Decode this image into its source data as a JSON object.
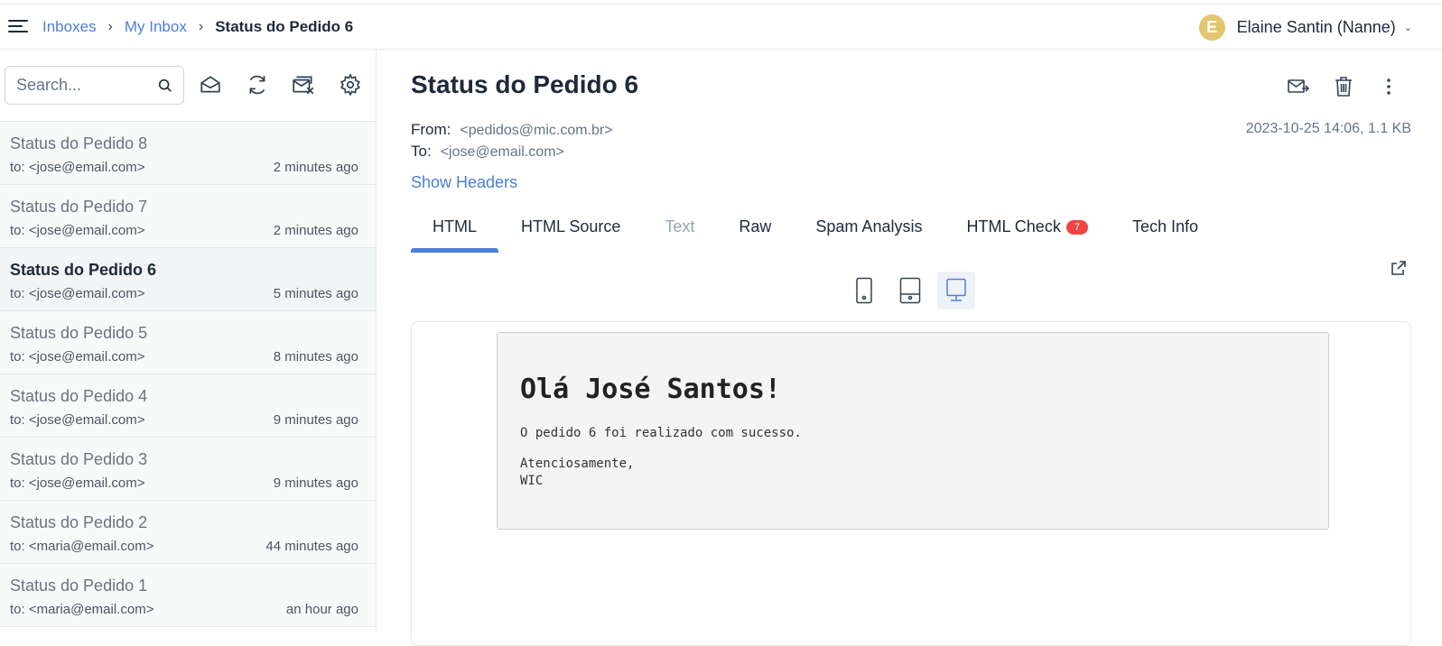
{
  "header": {
    "breadcrumb": [
      "Inboxes",
      "My Inbox",
      "Status do Pedido 6"
    ],
    "user_initial": "E",
    "user_name": "Elaine Santin (Nanne)"
  },
  "sidebar": {
    "search_placeholder": "Search...",
    "messages": [
      {
        "subject": "Status do Pedido 8",
        "to": "to: <jose@email.com>",
        "time": "2 minutes ago"
      },
      {
        "subject": "Status do Pedido 7",
        "to": "to: <jose@email.com>",
        "time": "2 minutes ago"
      },
      {
        "subject": "Status do Pedido 6",
        "to": "to: <jose@email.com>",
        "time": "5 minutes ago"
      },
      {
        "subject": "Status do Pedido 5",
        "to": "to: <jose@email.com>",
        "time": "8 minutes ago"
      },
      {
        "subject": "Status do Pedido 4",
        "to": "to: <jose@email.com>",
        "time": "9 minutes ago"
      },
      {
        "subject": "Status do Pedido 3",
        "to": "to: <jose@email.com>",
        "time": "9 minutes ago"
      },
      {
        "subject": "Status do Pedido 2",
        "to": "to: <maria@email.com>",
        "time": "44 minutes ago"
      },
      {
        "subject": "Status do Pedido 1",
        "to": "to: <maria@email.com>",
        "time": "an hour ago"
      }
    ]
  },
  "message": {
    "title": "Status do Pedido 6",
    "from_label": "From:",
    "from": "<pedidos@mic.com.br>",
    "to_label": "To:",
    "to": "<jose@email.com>",
    "date_size": "2023-10-25 14:06, 1.1 KB",
    "show_headers": "Show Headers",
    "tabs": [
      {
        "label": "HTML"
      },
      {
        "label": "HTML Source"
      },
      {
        "label": "Text"
      },
      {
        "label": "Raw"
      },
      {
        "label": "Spam Analysis"
      },
      {
        "label": "HTML Check",
        "badge": "7"
      },
      {
        "label": "Tech Info"
      }
    ],
    "body": {
      "heading": "Olá José Santos!",
      "line1": "O pedido 6 foi realizado com sucesso.",
      "line2": "Atenciosamente,",
      "line3": "WIC"
    }
  },
  "colors": {
    "accent": "#4a7fd6",
    "badge": "#ef4444",
    "avatar": "#e3c46f"
  }
}
